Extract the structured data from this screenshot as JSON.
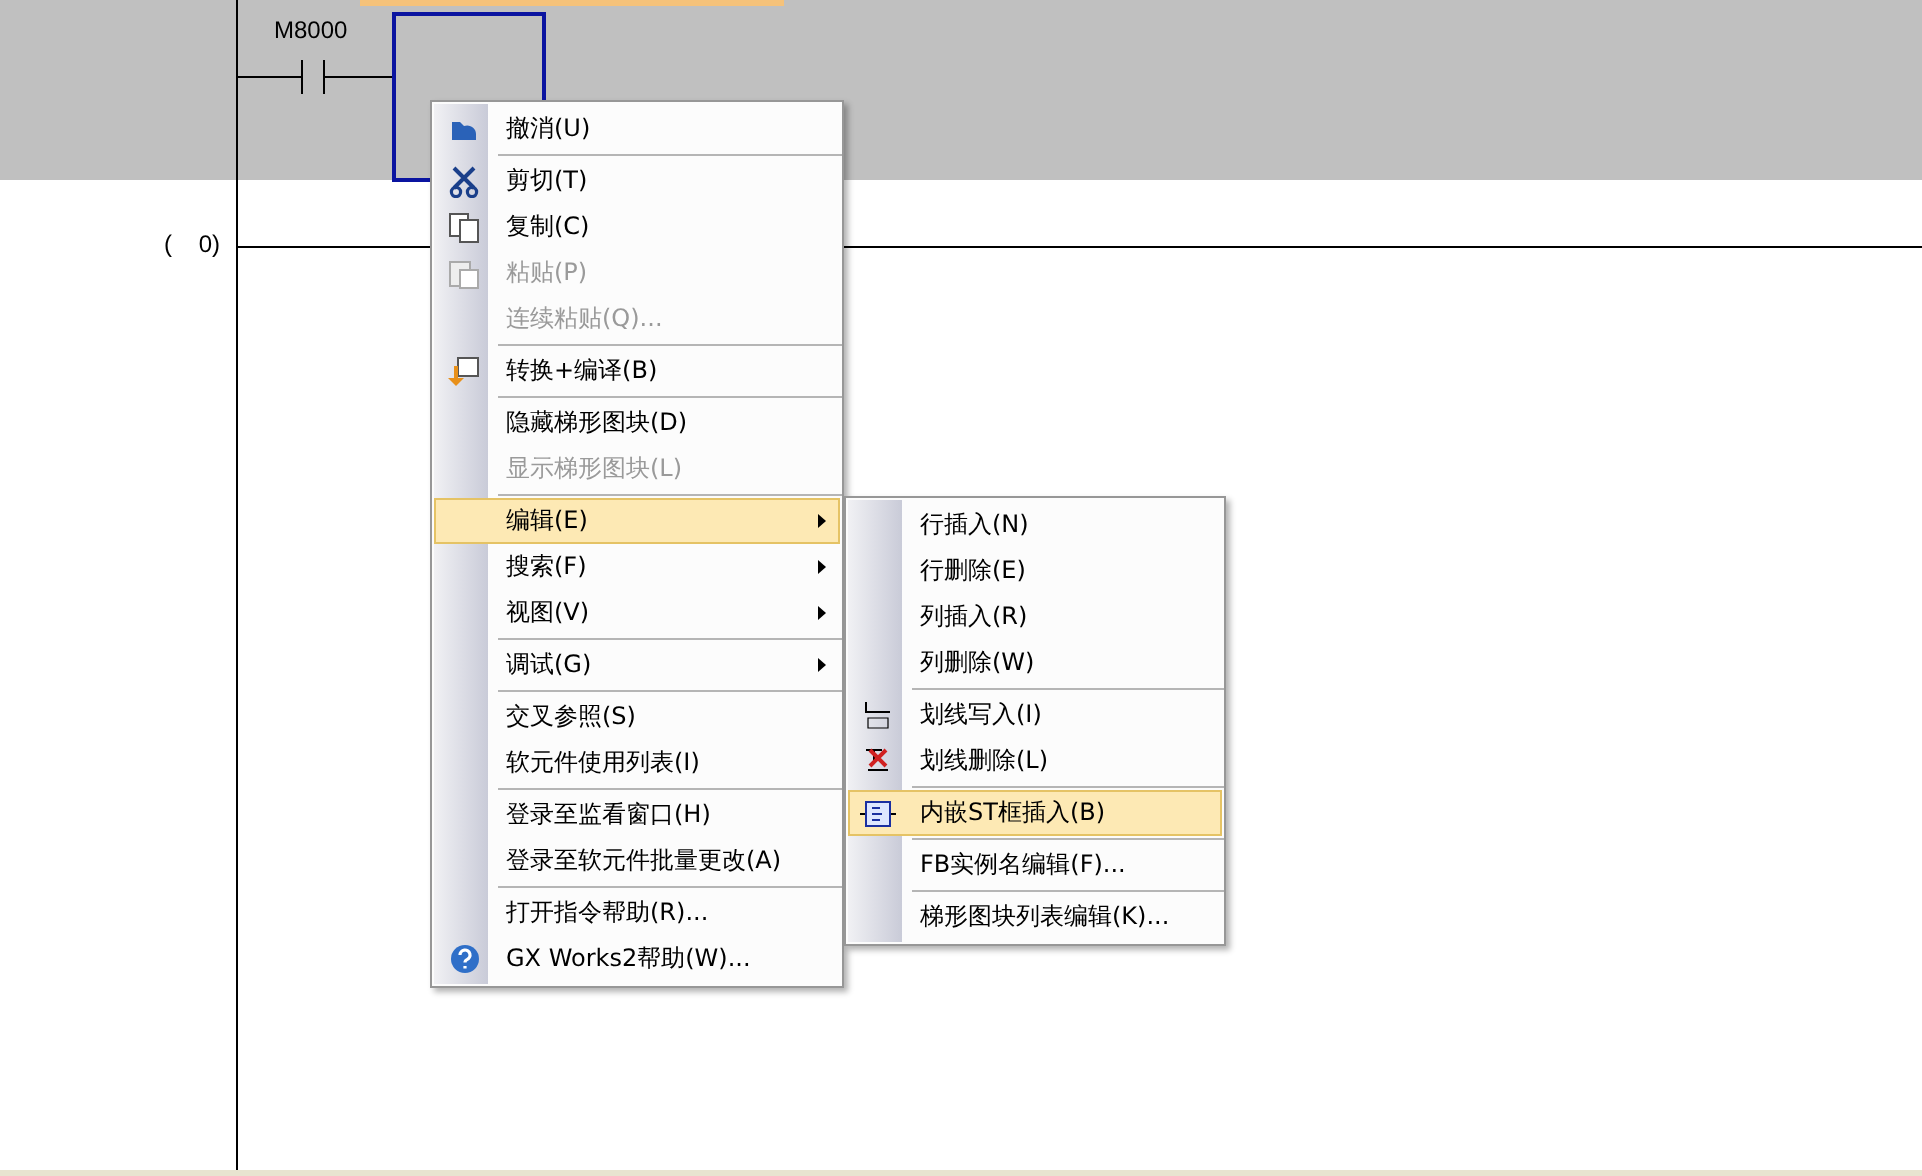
{
  "ladder": {
    "contact_label": "M8000",
    "step_number": "(    0)"
  },
  "context_menu": {
    "groups": [
      [
        {
          "label": "撤消(U)",
          "disabled": false,
          "selected": false,
          "submenu": false
        }
      ],
      [
        {
          "label": "剪切(T)",
          "disabled": false,
          "selected": false,
          "submenu": false
        },
        {
          "label": "复制(C)",
          "disabled": false,
          "selected": false,
          "submenu": false
        },
        {
          "label": "粘贴(P)",
          "disabled": true,
          "selected": false,
          "submenu": false
        },
        {
          "label": "连续粘贴(Q)...",
          "disabled": true,
          "selected": false,
          "submenu": false
        }
      ],
      [
        {
          "label": "转换+编译(B)",
          "disabled": false,
          "selected": false,
          "submenu": false
        }
      ],
      [
        {
          "label": "隐藏梯形图块(D)",
          "disabled": false,
          "selected": false,
          "submenu": false
        },
        {
          "label": "显示梯形图块(L)",
          "disabled": true,
          "selected": false,
          "submenu": false
        }
      ],
      [
        {
          "label": "编辑(E)",
          "disabled": false,
          "selected": true,
          "submenu": true
        },
        {
          "label": "搜索(F)",
          "disabled": false,
          "selected": false,
          "submenu": true
        },
        {
          "label": "视图(V)",
          "disabled": false,
          "selected": false,
          "submenu": true
        }
      ],
      [
        {
          "label": "调试(G)",
          "disabled": false,
          "selected": false,
          "submenu": true
        }
      ],
      [
        {
          "label": "交叉参照(S)",
          "disabled": false,
          "selected": false,
          "submenu": false
        },
        {
          "label": "软元件使用列表(I)",
          "disabled": false,
          "selected": false,
          "submenu": false
        }
      ],
      [
        {
          "label": "登录至监看窗口(H)",
          "disabled": false,
          "selected": false,
          "submenu": false
        },
        {
          "label": "登录至软元件批量更改(A)",
          "disabled": false,
          "selected": false,
          "submenu": false
        }
      ],
      [
        {
          "label": "打开指令帮助(R)...",
          "disabled": false,
          "selected": false,
          "submenu": false
        },
        {
          "label": "GX Works2帮助(W)...",
          "disabled": false,
          "selected": false,
          "submenu": false
        }
      ]
    ]
  },
  "edit_submenu": {
    "groups": [
      [
        {
          "label": "行插入(N)",
          "selected": false
        },
        {
          "label": "行删除(E)",
          "selected": false
        },
        {
          "label": "列插入(R)",
          "selected": false
        },
        {
          "label": "列删除(W)",
          "selected": false
        }
      ],
      [
        {
          "label": "划线写入(I)",
          "selected": false
        },
        {
          "label": "划线删除(L)",
          "selected": false
        }
      ],
      [
        {
          "label": "内嵌ST框插入(B)",
          "selected": true
        }
      ],
      [
        {
          "label": "FB实例名编辑(F)...",
          "selected": false
        }
      ],
      [
        {
          "label": "梯形图块列表编辑(K)...",
          "selected": false
        }
      ]
    ]
  }
}
